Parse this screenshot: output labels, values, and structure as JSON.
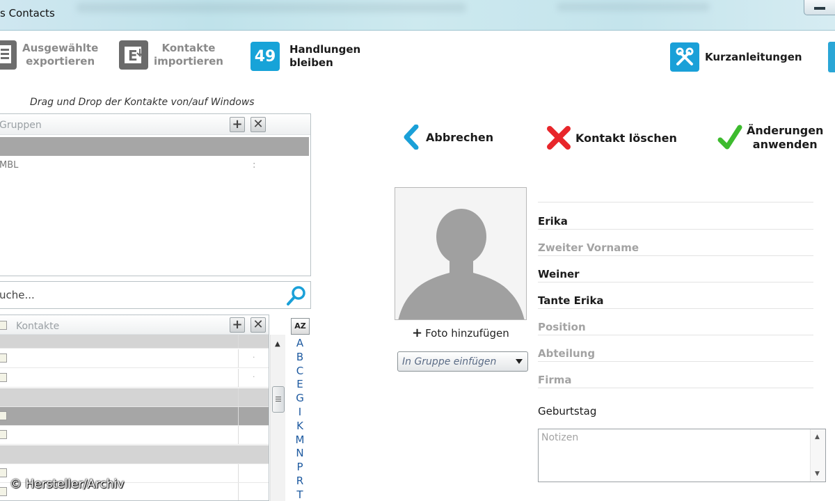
{
  "window": {
    "title": "s Contacts"
  },
  "toolbar": {
    "export_label": "Ausgewählte\nexportieren",
    "import_label": "Kontakte\nimportieren",
    "actions_count": "49",
    "actions_label": "Handlungen\nbleiben",
    "quickguide_label": "Kurzanleitungen"
  },
  "drag_hint": "Drag und Drop der Kontakte von/auf Windows",
  "groups": {
    "header": "Gruppen",
    "items": [
      {
        "label": "MBL",
        "dots": ":"
      }
    ]
  },
  "search": {
    "placeholder": "uche..."
  },
  "contacts": {
    "header": "Kontakte",
    "sort_label": "AZ",
    "alphabet": [
      "A",
      "B",
      "C",
      "E",
      "G",
      "I",
      "K",
      "M",
      "N",
      "P",
      "R",
      "T"
    ]
  },
  "actions": {
    "cancel": "Abbrechen",
    "delete": "Kontakt löschen",
    "apply": "Änderungen\nanwenden"
  },
  "photo": {
    "add_label": "Foto hinzufügen"
  },
  "group_select": {
    "value": "In Gruppe einfügen"
  },
  "form": {
    "first_name": "Erika",
    "middle_name_placeholder": "Zweiter Vorname",
    "last_name": "Weiner",
    "display_name": "Tante Erika",
    "position_placeholder": "Position",
    "department_placeholder": "Abteilung",
    "company_placeholder": "Firma",
    "birthday_label": "Geburtstag",
    "notes_placeholder": "Notizen"
  },
  "watermark": "© Hersteller/Archiv",
  "colors": {
    "accent_blue": "#1aa0d8",
    "delete_red": "#e8262b",
    "apply_green": "#3dbb2e",
    "selected_row": "#a6a6a6"
  }
}
